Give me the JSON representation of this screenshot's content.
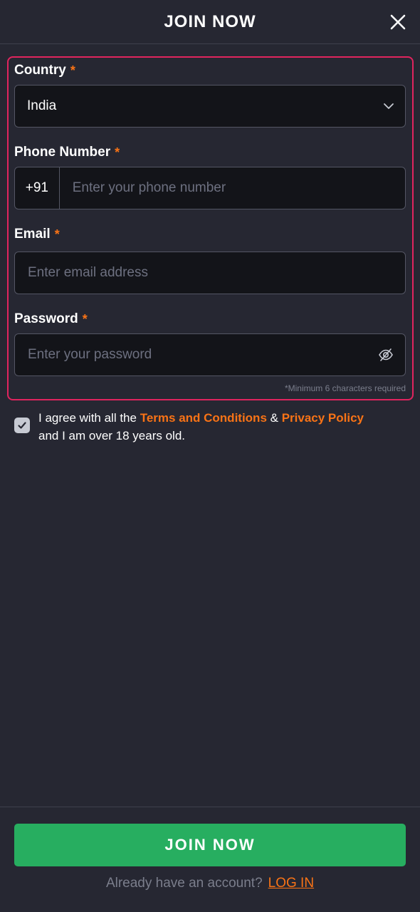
{
  "header": {
    "title": "JOIN NOW",
    "close_icon": "close-icon"
  },
  "form": {
    "country": {
      "label": "Country",
      "required_mark": "*",
      "value": "India",
      "icon": "chevron-down-icon"
    },
    "phone": {
      "label": "Phone Number",
      "required_mark": "*",
      "prefix": "+91",
      "placeholder": "Enter your phone number"
    },
    "email": {
      "label": "Email",
      "required_mark": "*",
      "placeholder": "Enter email address"
    },
    "password": {
      "label": "Password",
      "required_mark": "*",
      "placeholder": "Enter your password",
      "icon": "eye-off-icon",
      "hint": "*Minimum 6 characters required"
    }
  },
  "agreement": {
    "checked": true,
    "text_prefix": "I agree with all the ",
    "terms_link": "Terms and Conditions",
    "amp": " & ",
    "privacy_link": "Privacy Policy",
    "text_suffix": " and I am over 18 years old."
  },
  "footer": {
    "join_label": "JOIN NOW",
    "login_prompt": "Already have an account?",
    "login_link": "LOG IN"
  },
  "colors": {
    "background": "#262732",
    "accent": "#f97316",
    "error_border": "#e0245e",
    "primary_button": "#27ae60"
  }
}
